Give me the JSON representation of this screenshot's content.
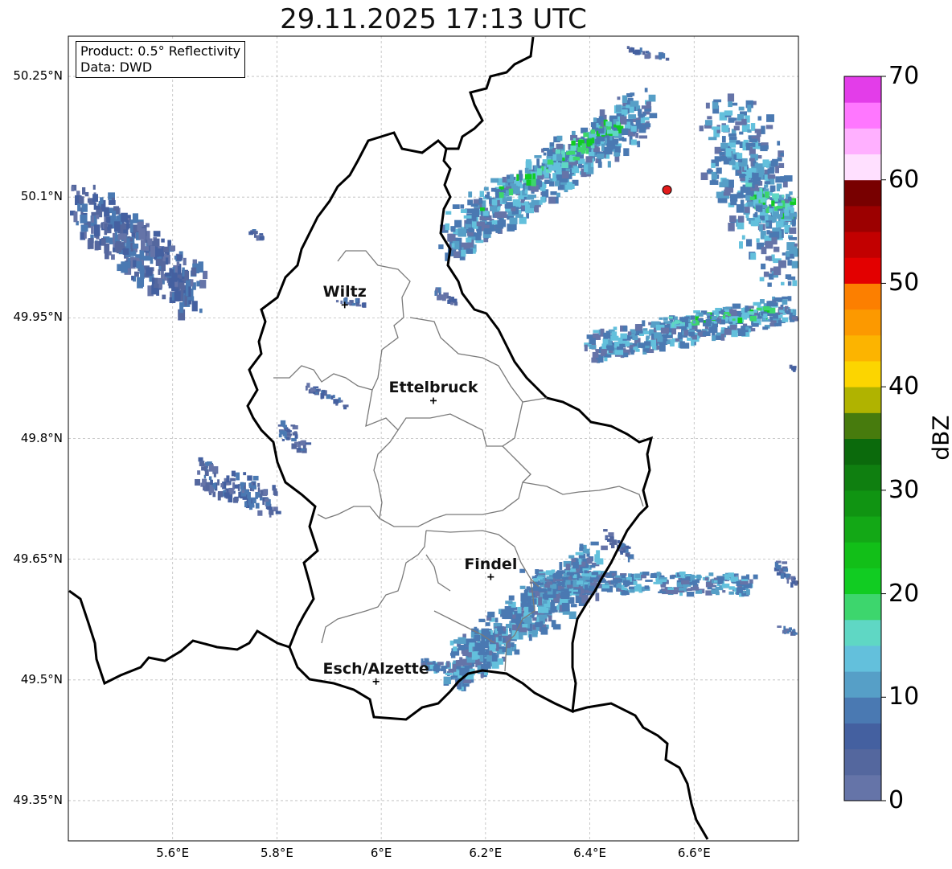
{
  "title": "29.11.2025 17:13 UTC",
  "info": {
    "product": "Product: 0.5° Reflectivity",
    "data": "Data: DWD"
  },
  "axes": {
    "lat_ticks": [
      "50.25°N",
      "50.1°N",
      "49.95°N",
      "49.8°N",
      "49.65°N",
      "49.5°N",
      "49.35°N"
    ],
    "lon_ticks": [
      "5.6°E",
      "5.8°E",
      "6°E",
      "6.2°E",
      "6.4°E",
      "6.6°E"
    ]
  },
  "cities": [
    {
      "name": "Wiltz",
      "lon": 5.93,
      "lat": 49.966
    },
    {
      "name": "Ettelbruck",
      "lon": 6.1,
      "lat": 49.847
    },
    {
      "name": "Findel",
      "lon": 6.21,
      "lat": 49.628
    },
    {
      "name": "Esch/Alzette",
      "lon": 5.99,
      "lat": 49.498
    }
  ],
  "radar_site": {
    "lon": 6.548,
    "lat": 50.109
  },
  "colorbar": {
    "label": "dBZ",
    "ticks": [
      "0",
      "10",
      "20",
      "30",
      "40",
      "50",
      "60",
      "70"
    ],
    "colors": [
      "#6574a8",
      "#54679e",
      "#4460a0",
      "#4a79b2",
      "#569fc7",
      "#63c0dc",
      "#5fd7c4",
      "#3dd66d",
      "#11cc22",
      "#12bf18",
      "#13a816",
      "#109412",
      "#0f7f10",
      "#0b6a0c",
      "#477b0d",
      "#b0b300",
      "#fcd500",
      "#fcb400",
      "#fc9900",
      "#fc7f00",
      "#e30000",
      "#c20000",
      "#9c0000",
      "#780000",
      "#ffe0ff",
      "#ffb0ff",
      "#ff77ff",
      "#e33de9"
    ]
  }
}
